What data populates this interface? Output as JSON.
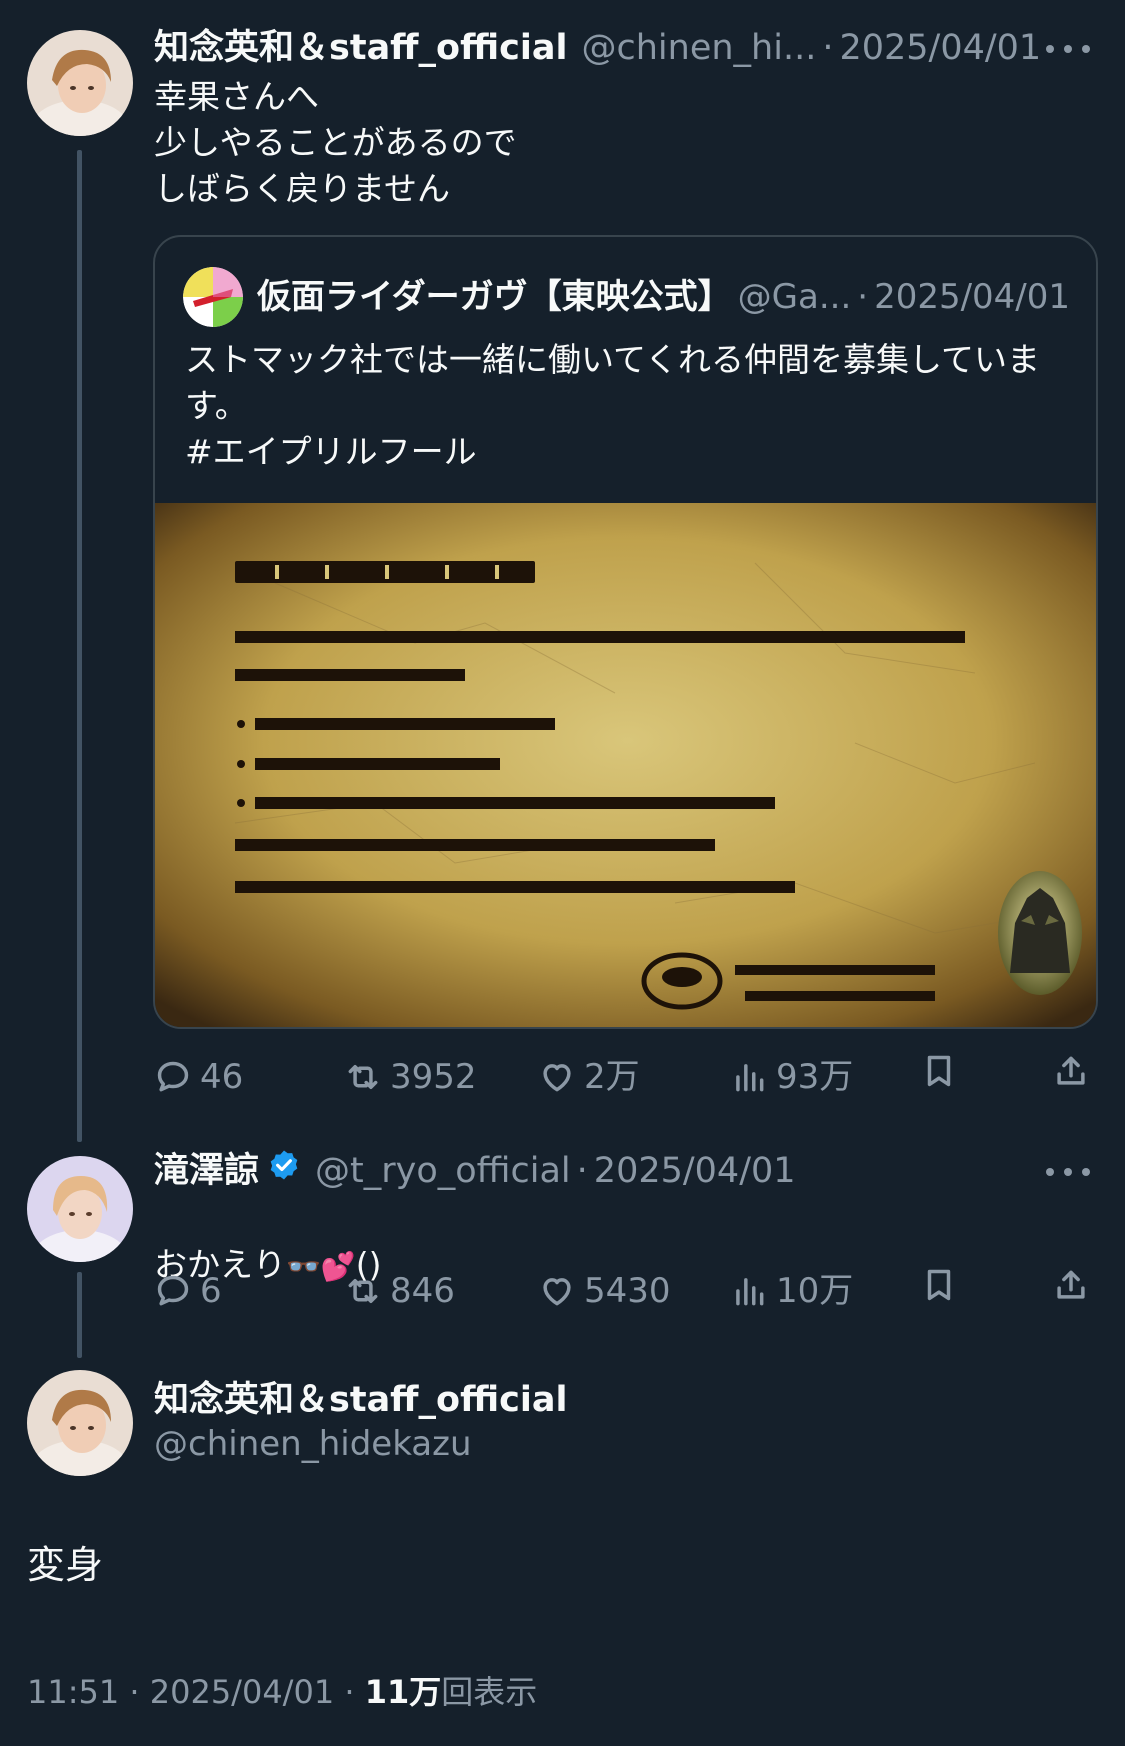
{
  "tweet1": {
    "name": "知念英和＆staff_official",
    "handle": "@chinen_hi...",
    "date": "2025/04/01",
    "text": "幸果さんへ\n少しやることがあるので\nしばらく戻りません",
    "quote": {
      "name": "仮面ライダーガヴ【東映公式】",
      "handle": "@Ga...",
      "date": "2025/04/01",
      "text": "ストマック社では一緒に働いてくれる仲間を募集していま\nす。\n#エイプリルフール"
    },
    "stats": {
      "replies": "46",
      "retweets": "3952",
      "likes": "2万",
      "views": "93万"
    }
  },
  "tweet2": {
    "name": "滝澤諒",
    "handle": "@t_ryo_official",
    "date": "2025/04/01",
    "text": "おかえり",
    "emoji_text": "👓💕",
    "text_suffix": "()",
    "stats": {
      "replies": "6",
      "retweets": "846",
      "likes": "5430",
      "views": "10万"
    }
  },
  "main": {
    "name": "知念英和＆staff_official",
    "handle": "@chinen_hidekazu",
    "text": "変身",
    "time": "11:51",
    "date": "2025/04/01",
    "views_count": "11万",
    "views_label": "回表示"
  },
  "icons": [
    "reply-icon",
    "retweet-icon",
    "like-icon",
    "views-icon",
    "bookmark-icon",
    "share-icon",
    "more-icon",
    "verified-badge-icon"
  ],
  "colors": {
    "background": "#15202b",
    "secondary_text": "#8b98a5",
    "verified": "#1d9bf0",
    "border": "#38444d"
  }
}
